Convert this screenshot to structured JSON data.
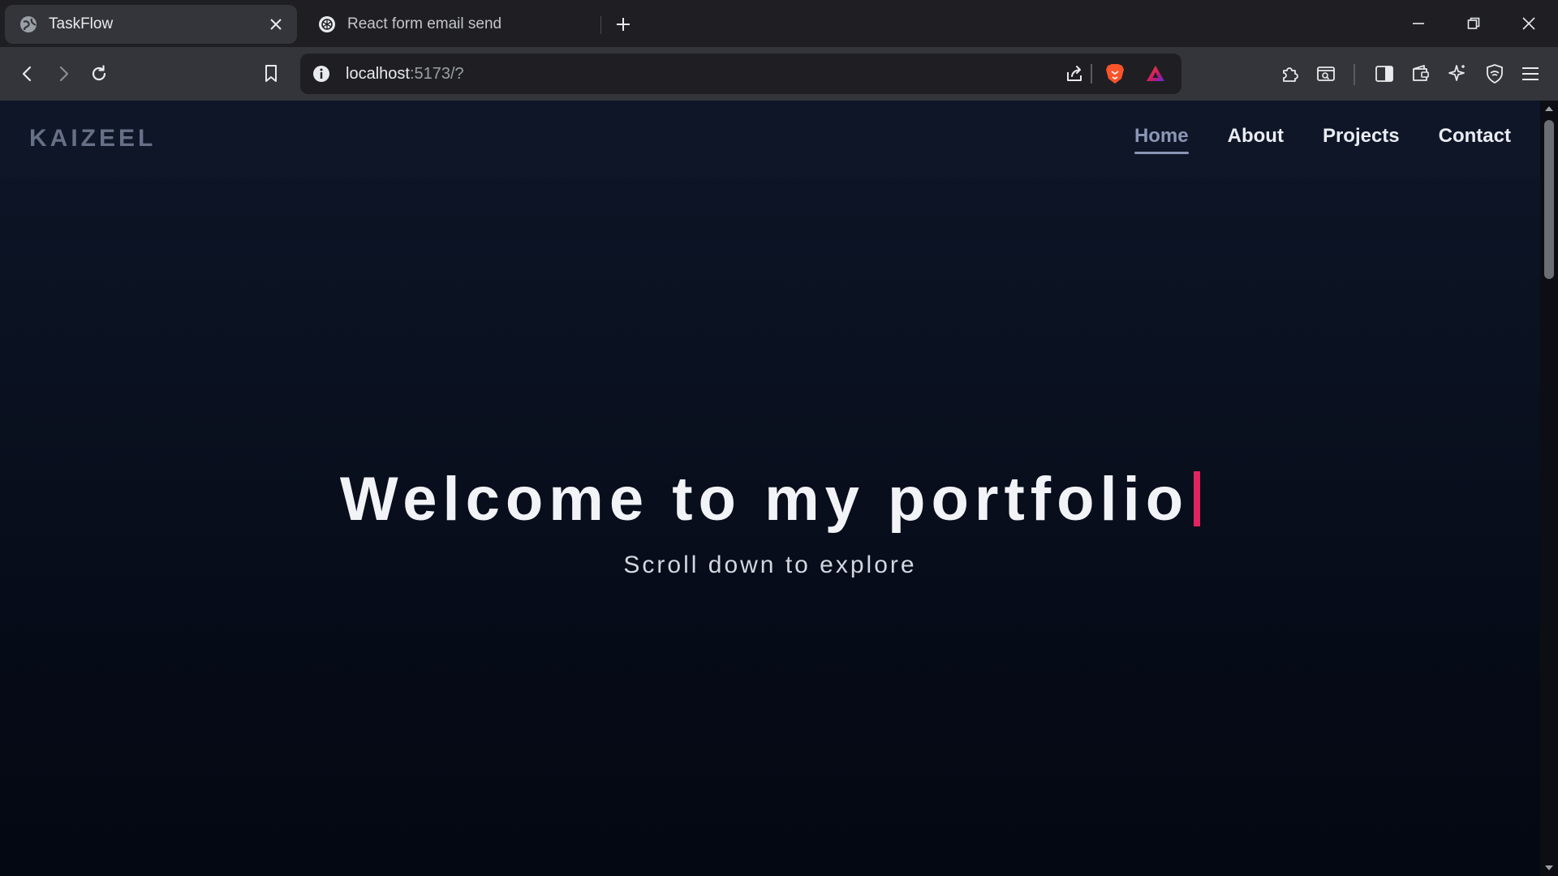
{
  "browser": {
    "tabs": [
      {
        "title": "TaskFlow",
        "favicon": "globe-icon",
        "active": true
      },
      {
        "title": "React form email send",
        "favicon": "openai-icon",
        "active": false
      }
    ],
    "address": {
      "host": "localhost",
      "rest": ":5173/?"
    },
    "colors": {
      "tab_active": "#34353a",
      "toolbar": "#34353a",
      "tabstrip": "#1f1f23"
    }
  },
  "site": {
    "brand": "KAIZEEL",
    "nav": [
      {
        "label": "Home",
        "active": true
      },
      {
        "label": "About",
        "active": false
      },
      {
        "label": "Projects",
        "active": false
      },
      {
        "label": "Contact",
        "active": false
      }
    ],
    "hero": {
      "title": "Welcome to my portfolio",
      "subtitle": "Scroll down to explore"
    },
    "colors": {
      "background": "#0a1120",
      "accent_cursor": "#e0245e",
      "nav_active": "#8b96b5",
      "brand": "#667086"
    }
  }
}
